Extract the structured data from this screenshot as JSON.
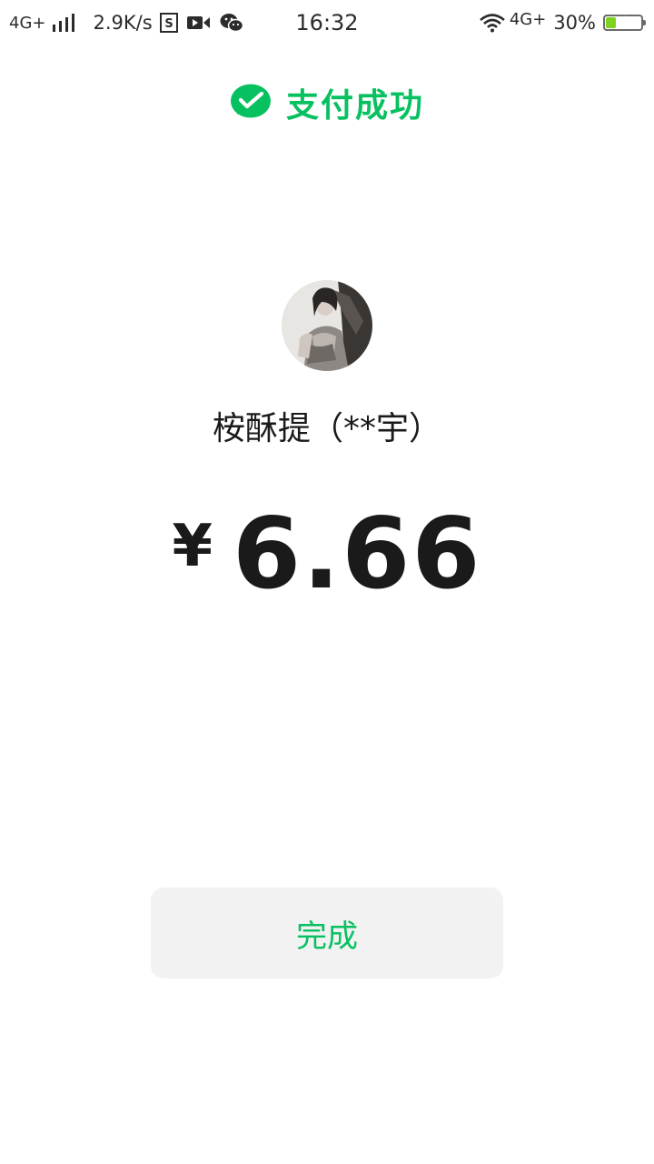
{
  "status_bar": {
    "network_left": "4G+",
    "speed": "2.9K/s",
    "time": "16:32",
    "network_right": "4G+",
    "battery_percent": "30%",
    "battery_level": 0.3,
    "icons": [
      "signal-icon",
      "s-app-icon",
      "video-icon",
      "wechat-icon",
      "wifi-icon",
      "battery-icon"
    ]
  },
  "header": {
    "title": "支付成功",
    "icon": "wechat-pay-check-icon",
    "accent_color": "#07c160"
  },
  "payee": {
    "name": "桉酥提（**宇）",
    "avatar": "user-avatar"
  },
  "payment": {
    "currency_symbol": "¥",
    "amount": "6.66"
  },
  "actions": {
    "done_label": "完成"
  }
}
